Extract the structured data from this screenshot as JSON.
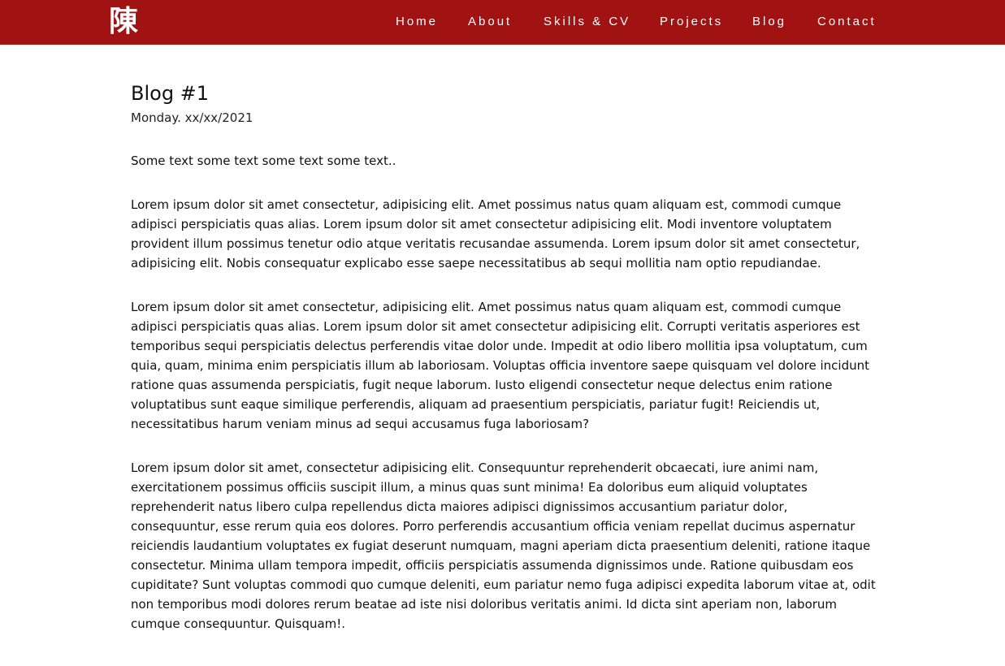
{
  "navbar": {
    "logo": "陳",
    "links": [
      "Home",
      "About",
      "Skills & CV",
      "Projects",
      "Blog",
      "Contact"
    ],
    "background_color": "#a11212"
  },
  "post": {
    "title": "Blog #1",
    "date": "Monday. xx/xx/2021",
    "intro": "Some text some text some text some text..",
    "paragraphs": [
      "Lorem ipsum dolor sit amet consectetur, adipisicing elit. Amet possimus natus quam aliquam est, commodi cumque adipisci perspiciatis quas alias. Lorem ipsum dolor sit amet consectetur adipisicing elit. Modi inventore voluptatem provident illum possimus tenetur odio atque veritatis recusandae assumenda. Lorem ipsum dolor sit amet consectetur, adipisicing elit. Nobis consequatur explicabo esse saepe necessitatibus ab sequi mollitia nam optio repudiandae.",
      "Lorem ipsum dolor sit amet consectetur, adipisicing elit. Amet possimus natus quam aliquam est, commodi cumque adipisci perspiciatis quas alias. Lorem ipsum dolor sit amet consectetur adipisicing elit. Corrupti veritatis asperiores est temporibus sequi perspiciatis delectus perferendis vitae dolor unde. Impedit at odio libero mollitia ipsa voluptatum, cum quia, quam, minima enim perspiciatis illum ab laboriosam. Voluptas officia inventore saepe quisquam vel dolore incidunt ratione quas assumenda perspiciatis, fugit neque laborum. Iusto eligendi consectetur neque delectus enim ratione voluptatibus sunt eaque similique perferendis, aliquam ad praesentium perspiciatis, pariatur fugit! Reiciendis ut, necessitatibus harum veniam minus ad sequi accusamus fuga laboriosam?",
      "Lorem ipsum dolor sit amet, consectetur adipisicing elit. Consequuntur reprehenderit obcaecati, iure animi nam, exercitationem possimus officiis suscipit illum, a minus quas sunt minima! Ea doloribus eum aliquid voluptates reprehenderit natus libero culpa repellendus dicta maiores adipisci dignissimos accusantium pariatur dolor, consequuntur, esse rerum quia eos dolores. Porro perferendis accusantium officia veniam repellat ducimus aspernatur reiciendis laudantium voluptates ex fugiat deserunt numquam, magni aperiam dicta praesentium deleniti, ratione itaque consectetur. Minima ullam tempora impedit, officiis perspiciatis assumenda dignissimos unde. Ratione quibusdam eos cupiditate? Sunt voluptas commodi quo cumque deleniti, eum pariatur nemo fuga adipisci expedita laborum vitae at, odit non temporibus modi dolores rerum beatae ad iste nisi doloribus veritatis animi. Id dicta sint aperiam non, laborum cumque consequuntur. Quisquam!."
    ]
  }
}
